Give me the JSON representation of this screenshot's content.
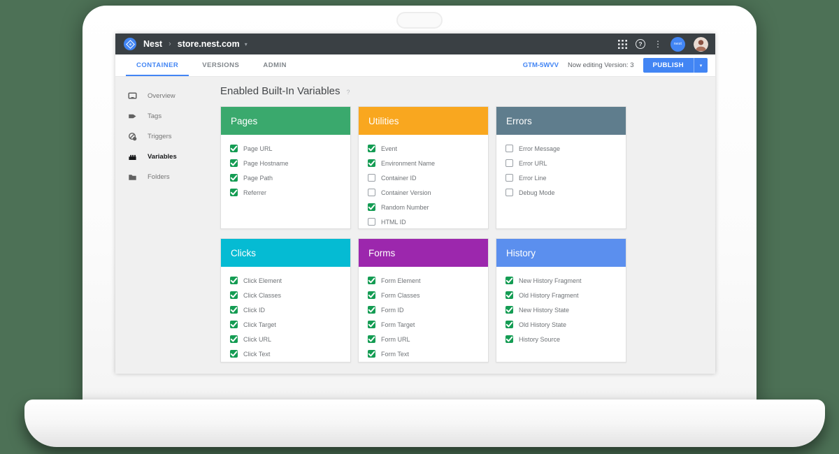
{
  "icons": {
    "breadcrumb_chevron": "›",
    "dropdown_caret": "▾",
    "more_vertical": "⋮",
    "help": "?",
    "publish_caret": "▾",
    "title_help": "?"
  },
  "topbar": {
    "brand": "Nest",
    "container": "store.nest.com",
    "badge": "nest"
  },
  "tabbar": {
    "tabs": [
      {
        "label": "CONTAINER",
        "active": true
      },
      {
        "label": "VERSIONS",
        "active": false
      },
      {
        "label": "ADMIN",
        "active": false
      }
    ],
    "gtm_id": "GTM-5WVV",
    "editing": "Now editing Version: 3",
    "publish": "PUBLISH"
  },
  "sidebar": {
    "items": [
      {
        "label": "Overview",
        "active": false
      },
      {
        "label": "Tags",
        "active": false
      },
      {
        "label": "Triggers",
        "active": false
      },
      {
        "label": "Variables",
        "active": true
      },
      {
        "label": "Folders",
        "active": false
      }
    ]
  },
  "main": {
    "title": "Enabled Built-In Variables",
    "cards": [
      {
        "title": "Pages",
        "color": "#3AA96D",
        "items": [
          {
            "label": "Page URL",
            "checked": true
          },
          {
            "label": "Page Hostname",
            "checked": true
          },
          {
            "label": "Page Path",
            "checked": true
          },
          {
            "label": "Referrer",
            "checked": true
          }
        ]
      },
      {
        "title": "Utilities",
        "color": "#F9A71F",
        "items": [
          {
            "label": "Event",
            "checked": true
          },
          {
            "label": "Environment Name",
            "checked": true
          },
          {
            "label": "Container ID",
            "checked": false
          },
          {
            "label": "Container Version",
            "checked": false
          },
          {
            "label": "Random Number",
            "checked": true
          },
          {
            "label": "HTML ID",
            "checked": false
          }
        ]
      },
      {
        "title": "Errors",
        "color": "#5F7D8D",
        "items": [
          {
            "label": "Error Message",
            "checked": false
          },
          {
            "label": "Error URL",
            "checked": false
          },
          {
            "label": "Error Line",
            "checked": false
          },
          {
            "label": "Debug Mode",
            "checked": false
          }
        ]
      },
      {
        "title": "Clicks",
        "color": "#05BBD3",
        "items": [
          {
            "label": "Click Element",
            "checked": true
          },
          {
            "label": "Click Classes",
            "checked": true
          },
          {
            "label": "Click ID",
            "checked": true
          },
          {
            "label": "Click Target",
            "checked": true
          },
          {
            "label": "Click URL",
            "checked": true
          },
          {
            "label": "Click Text",
            "checked": true
          }
        ]
      },
      {
        "title": "Forms",
        "color": "#9C27AD",
        "items": [
          {
            "label": "Form Element",
            "checked": true
          },
          {
            "label": "Form Classes",
            "checked": true
          },
          {
            "label": "Form ID",
            "checked": true
          },
          {
            "label": "Form Target",
            "checked": true
          },
          {
            "label": "Form URL",
            "checked": true
          },
          {
            "label": "Form Text",
            "checked": true
          }
        ]
      },
      {
        "title": "History",
        "color": "#5B8FEE",
        "items": [
          {
            "label": "New History Fragment",
            "checked": true
          },
          {
            "label": "Old History Fragment",
            "checked": true
          },
          {
            "label": "New History State",
            "checked": true
          },
          {
            "label": "Old History State",
            "checked": true
          },
          {
            "label": "History Source",
            "checked": true
          }
        ]
      }
    ]
  },
  "colors": {
    "accent_blue": "#4285F4",
    "checkbox_green": "#149C53",
    "topbar_bg": "#3A4044",
    "background_green": "#4D7156"
  }
}
